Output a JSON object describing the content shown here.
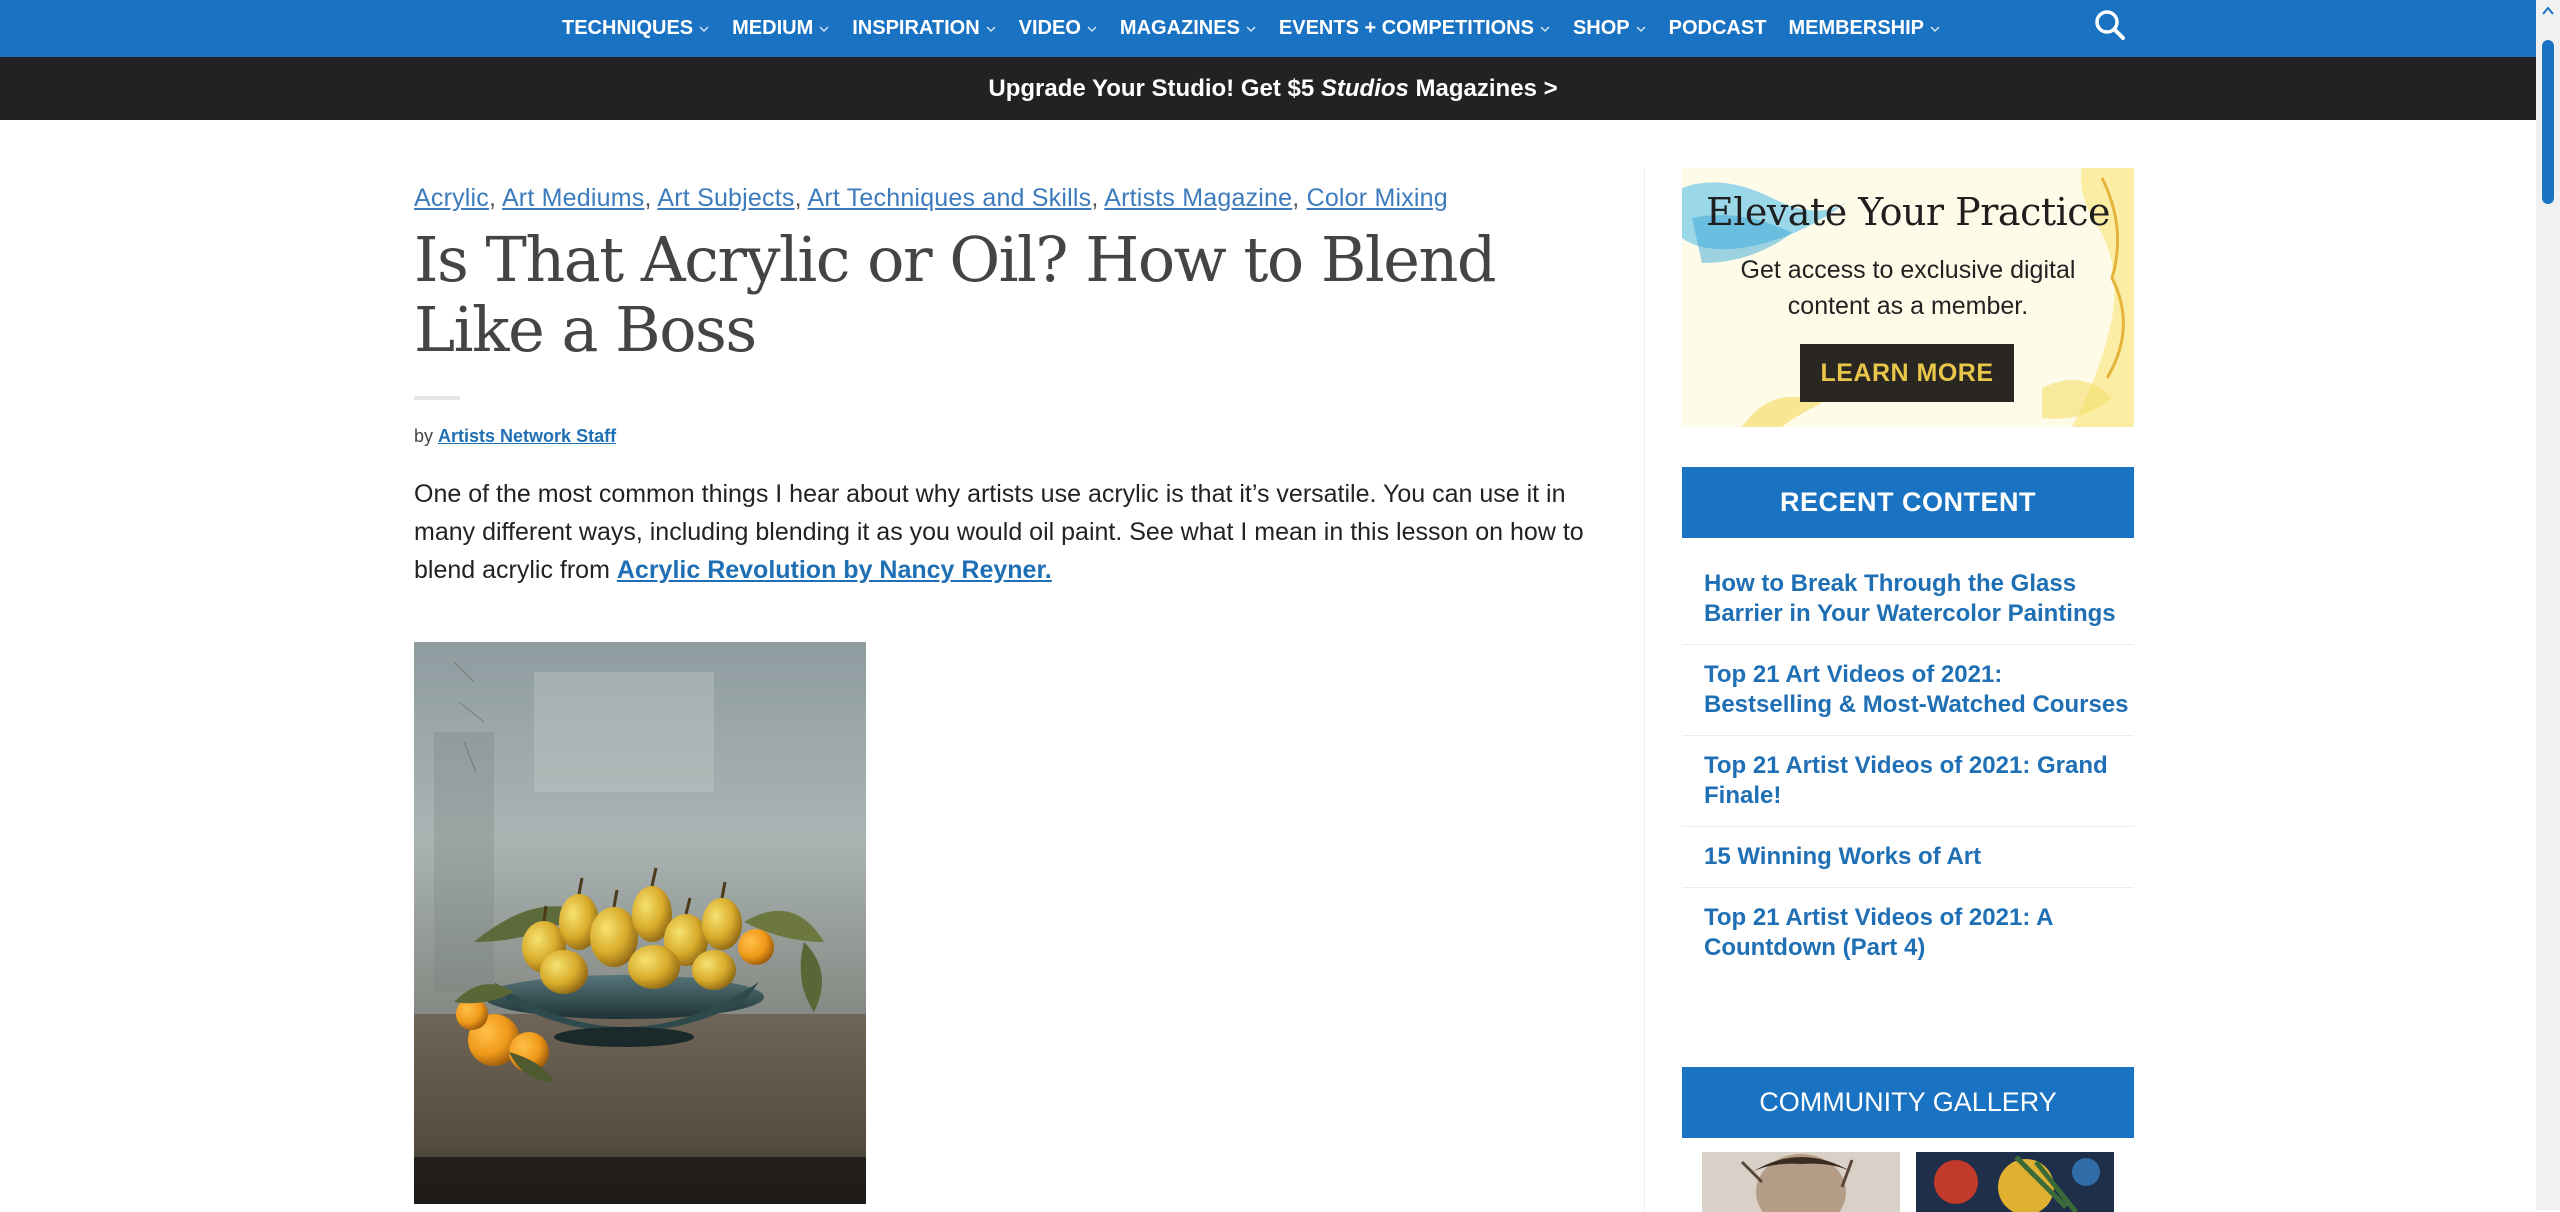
{
  "nav": {
    "items": [
      {
        "label": "TECHNIQUES",
        "has_dropdown": true
      },
      {
        "label": "MEDIUM",
        "has_dropdown": true
      },
      {
        "label": "INSPIRATION",
        "has_dropdown": true
      },
      {
        "label": "VIDEO",
        "has_dropdown": true
      },
      {
        "label": "MAGAZINES",
        "has_dropdown": true
      },
      {
        "label": "EVENTS + COMPETITIONS",
        "has_dropdown": true
      },
      {
        "label": "SHOP",
        "has_dropdown": true
      },
      {
        "label": "PODCAST",
        "has_dropdown": false
      },
      {
        "label": "MEMBERSHIP",
        "has_dropdown": true
      }
    ],
    "search_icon": "search-icon"
  },
  "promo": {
    "before": "Upgrade Your Studio! Get $5 ",
    "emphasis": "Studios",
    "after": " Magazines >"
  },
  "article": {
    "categories": [
      "Acrylic",
      "Art Mediums",
      "Art Subjects",
      "Art Techniques and Skills",
      "Artists Magazine",
      "Color Mixing"
    ],
    "title": "Is That Acrylic or Oil? How to Blend Like a Boss",
    "byline_prefix": "by",
    "author": "Artists Network Staff",
    "intro_text": "One of the most common things I hear about why artists use acrylic is that it’s versatile. You can use it in many different ways, including blending it as you would oil paint. See what I mean in this lesson on how to blend acrylic from ",
    "intro_link": "Acrylic Revolution by Nancy Reyner."
  },
  "sidebar": {
    "ad": {
      "title": "Elevate Your Practice",
      "subtitle": "Get access to exclusive digital content as a member.",
      "button": "LEARN MORE"
    },
    "recent_header": "RECENT CONTENT",
    "recent_items": [
      "How to Break Through the Glass Barrier in Your Watercolor Paintings",
      "Top 21 Art Videos of 2021: Bestselling & Most-Watched Courses",
      "Top 21 Artist Videos of 2021: Grand Finale!",
      "15 Winning Works of Art",
      "Top 21 Artist Videos of 2021: A Countdown (Part 4)"
    ],
    "gallery_header": "COMMUNITY GALLERY"
  },
  "colors": {
    "brand_blue": "#1a73c2",
    "promo_bg": "#222222",
    "link_blue": "#1f6fb5"
  }
}
